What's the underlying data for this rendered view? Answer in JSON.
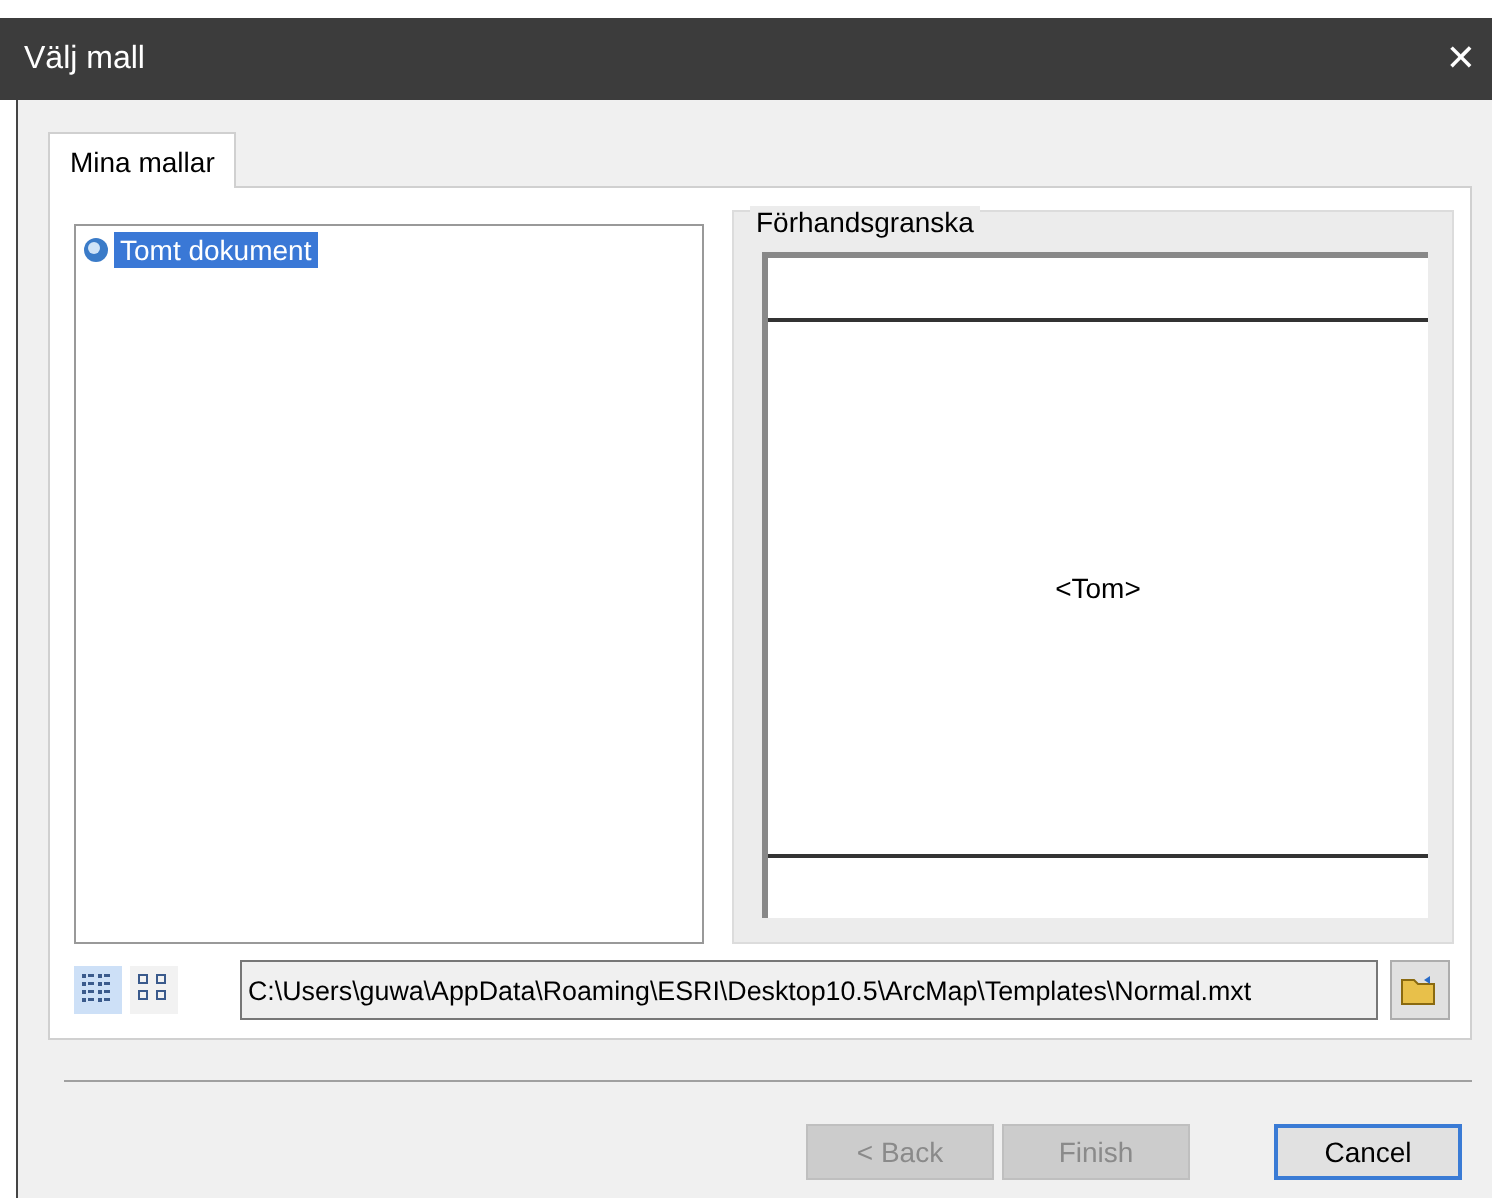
{
  "window": {
    "title": "Välj mall",
    "close": "✕"
  },
  "tabs": [
    {
      "label": "Mina mallar",
      "selected": true
    }
  ],
  "templates": [
    {
      "label": "Tomt dokument",
      "selected": true
    }
  ],
  "preview": {
    "title": "Förhandsgranska",
    "content": "<Tom>"
  },
  "view_modes": [
    {
      "kind": "details",
      "selected": true
    },
    {
      "kind": "icons",
      "selected": false
    }
  ],
  "path_field": {
    "value": "C:\\Users\\guwa\\AppData\\Roaming\\ESRI\\Desktop10.5\\ArcMap\\Templates\\Normal.mxt"
  },
  "buttons": [
    {
      "label": "< Back",
      "disabled": true,
      "default": false
    },
    {
      "label": "Finish",
      "disabled": true,
      "default": false
    },
    {
      "label": "Cancel",
      "disabled": false,
      "default": true
    }
  ]
}
